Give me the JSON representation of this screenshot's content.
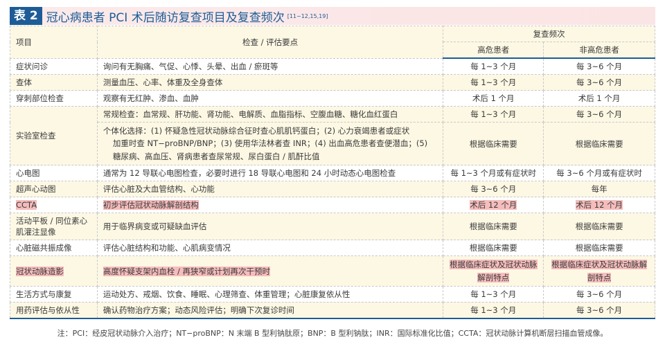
{
  "title": {
    "tag": "表 2",
    "text": "冠心病患者 PCI 术后随访复查项目及复查频次",
    "ref": "[11−12,15,19]"
  },
  "header": {
    "item": "项目",
    "check": "检查 / 评估要点",
    "freq": "复查频次",
    "high": "高危患者",
    "nonhigh": "非高危患者"
  },
  "rows": [
    {
      "item": "症状问诊",
      "check": "询问有无胸痛、气促、心悸、头晕、出血 / 瘀斑等",
      "high": "每 1~3 个月",
      "nonhigh": "每 3~6 个月"
    },
    {
      "item": "查体",
      "check": "测量血压、心率、体重及全身查体",
      "high": "每 1~3 个月",
      "nonhigh": "每 3~6 个月"
    },
    {
      "item": "穿刺部位检查",
      "check": "观察有无红肿、渗血、血肿",
      "high": "术后 1 个月",
      "nonhigh": "术后 1 个月"
    },
    {
      "item": "实验室检查",
      "check": "常规检查：血常规、肝功能、肾功能、电解质、血脂指标、空腹血糖、糖化血红蛋白",
      "high": "每 1~3 个月",
      "nonhigh": "每 3~6 个月",
      "check2a": "个体化选择：(1) 怀疑急性冠状动脉综合征时查心肌肌钙蛋白；(2) 心力衰竭患者或症状",
      "check2b": "加重时查 NT−proBNP/BNP；(3) 使用华法林者查 INR；(4) 出血高危患者查便潜血；(5) 糖尿病、高血压、肾病患者查尿常规、尿白蛋白 / 肌酐比值",
      "high2": "根据临床需要",
      "nonhigh2": "根据临床需要"
    },
    {
      "item": "心电图",
      "check": "通常为 12 导联心电图检查，必要时进行 18 导联心电图和 24 小时动态心电图检查",
      "high": "每 1~3 个月或有症状时",
      "nonhigh": "每 3~6 个月或有症状时"
    },
    {
      "item": "超声心动图",
      "check": "评估心脏及大血管结构、心功能",
      "high": "每 3~6 个月",
      "nonhigh": "每年"
    },
    {
      "item": "CCTA",
      "check": "初步评估冠状动脉解剖结构",
      "high": "术后 12 个月",
      "nonhigh": "术后 12 个月"
    },
    {
      "item": "活动平板 / 同位素心肌灌注显像",
      "check": "用于临界病变或可疑缺血评估",
      "high": "根据临床需要",
      "nonhigh": "根据临床需要"
    },
    {
      "item": "心脏磁共振成像",
      "check": "评估心脏结构和功能、心肌病变情况",
      "high": "根据临床需要",
      "nonhigh": "根据临床需要"
    },
    {
      "item": "冠状动脉造影",
      "check": "高度怀疑支架内血栓 / 再狭窄或计划再次干预时",
      "high": "根据临床症状及冠状动脉解剖特点",
      "nonhigh": "根据临床症状及冠状动脉解剖特点"
    },
    {
      "item": "生活方式与康复",
      "check": "运动处方、戒烟、饮食、睡眠、心理筛查、体重管理；心脏康复依从性",
      "high": "每 1~3 个月",
      "nonhigh": "每 3~6 个月"
    },
    {
      "item": "用药评估与依从性",
      "check": "确认药物治疗方案；动态风险评估；明确下次复诊时间",
      "high": "每 1~3 个月",
      "nonhigh": "每 3~6 个月"
    }
  ],
  "note": "注：PCI：经皮冠状动脉介入治疗；NT−proBNP：N 末端 B 型利钠肽原；BNP：B 型利钠肽；INR：国际标准化比值；CCTA：冠状动脉计算机断层扫描血管成像。"
}
